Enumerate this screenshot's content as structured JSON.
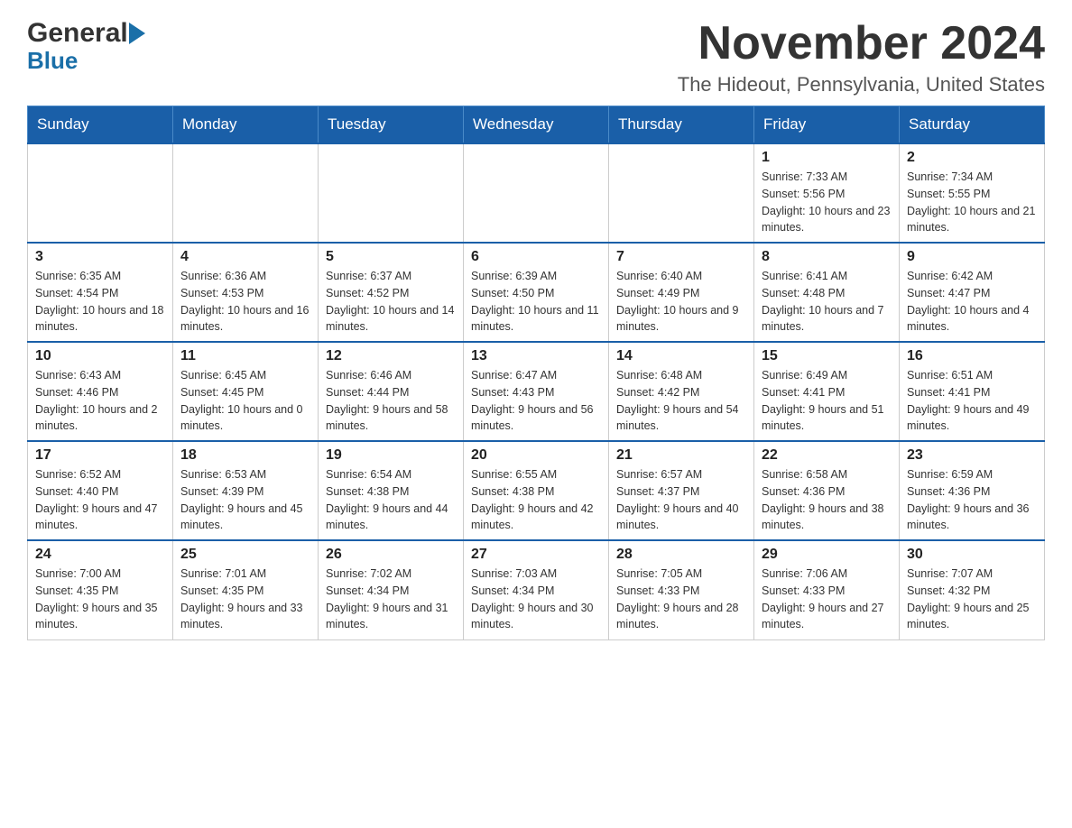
{
  "logo": {
    "general": "General",
    "blue": "Blue"
  },
  "title": "November 2024",
  "subtitle": "The Hideout, Pennsylvania, United States",
  "weekdays": [
    "Sunday",
    "Monday",
    "Tuesday",
    "Wednesday",
    "Thursday",
    "Friday",
    "Saturday"
  ],
  "weeks": [
    [
      {
        "day": "",
        "info": ""
      },
      {
        "day": "",
        "info": ""
      },
      {
        "day": "",
        "info": ""
      },
      {
        "day": "",
        "info": ""
      },
      {
        "day": "",
        "info": ""
      },
      {
        "day": "1",
        "info": "Sunrise: 7:33 AM\nSunset: 5:56 PM\nDaylight: 10 hours and 23 minutes."
      },
      {
        "day": "2",
        "info": "Sunrise: 7:34 AM\nSunset: 5:55 PM\nDaylight: 10 hours and 21 minutes."
      }
    ],
    [
      {
        "day": "3",
        "info": "Sunrise: 6:35 AM\nSunset: 4:54 PM\nDaylight: 10 hours and 18 minutes."
      },
      {
        "day": "4",
        "info": "Sunrise: 6:36 AM\nSunset: 4:53 PM\nDaylight: 10 hours and 16 minutes."
      },
      {
        "day": "5",
        "info": "Sunrise: 6:37 AM\nSunset: 4:52 PM\nDaylight: 10 hours and 14 minutes."
      },
      {
        "day": "6",
        "info": "Sunrise: 6:39 AM\nSunset: 4:50 PM\nDaylight: 10 hours and 11 minutes."
      },
      {
        "day": "7",
        "info": "Sunrise: 6:40 AM\nSunset: 4:49 PM\nDaylight: 10 hours and 9 minutes."
      },
      {
        "day": "8",
        "info": "Sunrise: 6:41 AM\nSunset: 4:48 PM\nDaylight: 10 hours and 7 minutes."
      },
      {
        "day": "9",
        "info": "Sunrise: 6:42 AM\nSunset: 4:47 PM\nDaylight: 10 hours and 4 minutes."
      }
    ],
    [
      {
        "day": "10",
        "info": "Sunrise: 6:43 AM\nSunset: 4:46 PM\nDaylight: 10 hours and 2 minutes."
      },
      {
        "day": "11",
        "info": "Sunrise: 6:45 AM\nSunset: 4:45 PM\nDaylight: 10 hours and 0 minutes."
      },
      {
        "day": "12",
        "info": "Sunrise: 6:46 AM\nSunset: 4:44 PM\nDaylight: 9 hours and 58 minutes."
      },
      {
        "day": "13",
        "info": "Sunrise: 6:47 AM\nSunset: 4:43 PM\nDaylight: 9 hours and 56 minutes."
      },
      {
        "day": "14",
        "info": "Sunrise: 6:48 AM\nSunset: 4:42 PM\nDaylight: 9 hours and 54 minutes."
      },
      {
        "day": "15",
        "info": "Sunrise: 6:49 AM\nSunset: 4:41 PM\nDaylight: 9 hours and 51 minutes."
      },
      {
        "day": "16",
        "info": "Sunrise: 6:51 AM\nSunset: 4:41 PM\nDaylight: 9 hours and 49 minutes."
      }
    ],
    [
      {
        "day": "17",
        "info": "Sunrise: 6:52 AM\nSunset: 4:40 PM\nDaylight: 9 hours and 47 minutes."
      },
      {
        "day": "18",
        "info": "Sunrise: 6:53 AM\nSunset: 4:39 PM\nDaylight: 9 hours and 45 minutes."
      },
      {
        "day": "19",
        "info": "Sunrise: 6:54 AM\nSunset: 4:38 PM\nDaylight: 9 hours and 44 minutes."
      },
      {
        "day": "20",
        "info": "Sunrise: 6:55 AM\nSunset: 4:38 PM\nDaylight: 9 hours and 42 minutes."
      },
      {
        "day": "21",
        "info": "Sunrise: 6:57 AM\nSunset: 4:37 PM\nDaylight: 9 hours and 40 minutes."
      },
      {
        "day": "22",
        "info": "Sunrise: 6:58 AM\nSunset: 4:36 PM\nDaylight: 9 hours and 38 minutes."
      },
      {
        "day": "23",
        "info": "Sunrise: 6:59 AM\nSunset: 4:36 PM\nDaylight: 9 hours and 36 minutes."
      }
    ],
    [
      {
        "day": "24",
        "info": "Sunrise: 7:00 AM\nSunset: 4:35 PM\nDaylight: 9 hours and 35 minutes."
      },
      {
        "day": "25",
        "info": "Sunrise: 7:01 AM\nSunset: 4:35 PM\nDaylight: 9 hours and 33 minutes."
      },
      {
        "day": "26",
        "info": "Sunrise: 7:02 AM\nSunset: 4:34 PM\nDaylight: 9 hours and 31 minutes."
      },
      {
        "day": "27",
        "info": "Sunrise: 7:03 AM\nSunset: 4:34 PM\nDaylight: 9 hours and 30 minutes."
      },
      {
        "day": "28",
        "info": "Sunrise: 7:05 AM\nSunset: 4:33 PM\nDaylight: 9 hours and 28 minutes."
      },
      {
        "day": "29",
        "info": "Sunrise: 7:06 AM\nSunset: 4:33 PM\nDaylight: 9 hours and 27 minutes."
      },
      {
        "day": "30",
        "info": "Sunrise: 7:07 AM\nSunset: 4:32 PM\nDaylight: 9 hours and 25 minutes."
      }
    ]
  ]
}
